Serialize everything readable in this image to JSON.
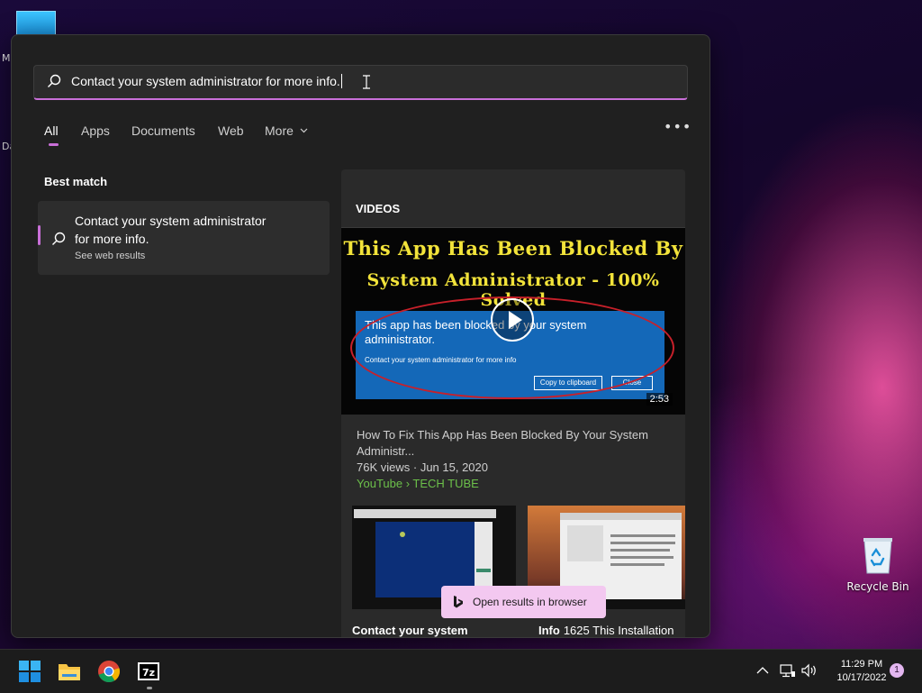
{
  "desktop": {
    "edge_letters": [
      "M",
      "Da"
    ],
    "recycle_bin_label": "Recycle Bin"
  },
  "search": {
    "query": "Contact your system administrator for more info."
  },
  "tabs": [
    "All",
    "Apps",
    "Documents",
    "Web",
    "More"
  ],
  "active_tab": "All",
  "best_match": {
    "section_label": "Best match",
    "title_line1": "Contact your system administrator",
    "title_line2": "for more info.",
    "subtitle": "See web results"
  },
  "videos": {
    "section_label": "VIDEOS",
    "thumbnail": {
      "headline_line1": "This App Has Been Blocked By",
      "headline_line2": "System Administrator - 100% Solved",
      "dialog_text": "This app has been blocked by your system administrator.",
      "dialog_subtext": "Contact your system administrator for more info",
      "copy_button": "Copy to clipboard",
      "close_button": "Close",
      "duration": "2:53"
    },
    "title": "How To Fix This App Has Been Blocked By Your System Administr...",
    "views": "76K views",
    "date": "Jun 15, 2020",
    "source": "YouTube › TECH TUBE",
    "more_captions": {
      "left": "Contact your system",
      "right_bold": "Info",
      "right_rest": "1625 This Installation"
    }
  },
  "open_in_browser_label": "Open results in browser",
  "taskbar": {
    "apps": [
      "start-icon",
      "file-explorer-icon",
      "chrome-icon",
      "7zip-icon"
    ],
    "time": "11:29 PM",
    "date": "10/17/2022",
    "notification_count": "1"
  },
  "colors": {
    "accent": "#c96fd8",
    "source_green": "#6cc04a",
    "open_button_bg": "#f3c8f0"
  }
}
